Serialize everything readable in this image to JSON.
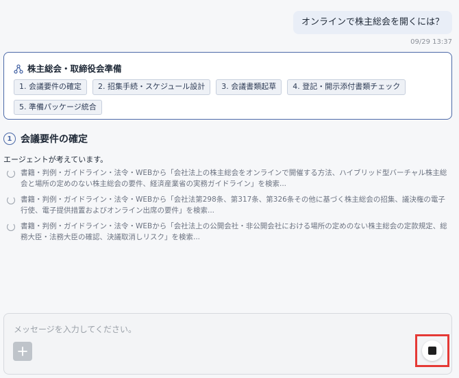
{
  "colors": {
    "accent": "#4a68a7",
    "highlight": "#e53935",
    "user_bubble": "#e9eef7"
  },
  "chat": {
    "user_message": "オンラインで株主総会を開くには？",
    "user_timestamp": "09/29 13:37"
  },
  "plan": {
    "icon": "workflow-icon",
    "title": "株主総会・取締役会準備",
    "steps": [
      {
        "label": "1. 会議要件の確定"
      },
      {
        "label": "2. 招集手続・スケジュール設計"
      },
      {
        "label": "3. 会議書類起草"
      },
      {
        "label": "4. 登記・開示添付書類チェック"
      },
      {
        "label": "5. 準備パッケージ統合"
      }
    ]
  },
  "section": {
    "number": "1",
    "title": "会議要件の確定",
    "status": "エージェントが考えています。",
    "searches": [
      {
        "text": "書籍・判例・ガイドライン・法令・WEBから「会社法上の株主総会をオンラインで開催する方法、ハイブリッド型バーチャル株主総会と場所の定めのない株主総会の要件、経済産業省の実務ガイドライン」を検索..."
      },
      {
        "text": "書籍・判例・ガイドライン・法令・WEBから「会社法第298条、第317条、第326条その他に基づく株主総会の招集、議決権の電子行使、電子提供措置およびオンライン出席の要件」を検索..."
      },
      {
        "text": "書籍・判例・ガイドライン・法令・WEBから「会社法上の公開会社・非公開会社における場所の定めのない株主総会の定款規定、総務大臣・法務大臣の確認、決議取消しリスク」を検索..."
      }
    ]
  },
  "composer": {
    "placeholder": "メッセージを入力してください。",
    "add_icon": "plus-icon",
    "stop_icon": "stop-icon"
  }
}
